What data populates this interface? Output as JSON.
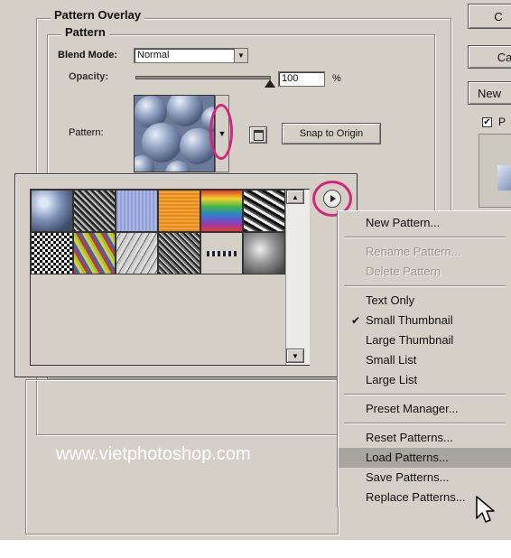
{
  "dialog": {
    "section_title": "Pattern Overlay",
    "group_title": "Pattern",
    "blend_mode_label": "Blend Mode:",
    "blend_mode_value": "Normal",
    "opacity_label": "Opacity:",
    "opacity_value": "100",
    "opacity_unit": "%",
    "opacity_level": 1.0,
    "pattern_label": "Pattern:",
    "snap_button": "Snap to Origin"
  },
  "right_panel": {
    "button_top": "C",
    "button_cancel": "Ca",
    "button_new": "New",
    "preview_checkbox": "P",
    "preview_checked": true
  },
  "picker": {
    "thumbnails": [
      "bubbles",
      "gray-noise",
      "blue-stripes",
      "orange-fabric",
      "rainbow-stripes",
      "black-white-confetti",
      "checker-dots",
      "colorful-confetti",
      "gray-scribble",
      "bw-noise",
      "chain",
      "gray-clouds"
    ]
  },
  "menu": {
    "items": [
      {
        "label": "New Pattern...",
        "enabled": true,
        "checked": false
      },
      {
        "sep": true
      },
      {
        "label": "Rename Pattern...",
        "enabled": false,
        "checked": false
      },
      {
        "label": "Delete Pattern",
        "enabled": false,
        "checked": false
      },
      {
        "sep": true
      },
      {
        "label": "Text Only",
        "enabled": true,
        "checked": false
      },
      {
        "label": "Small Thumbnail",
        "enabled": true,
        "checked": true
      },
      {
        "label": "Large Thumbnail",
        "enabled": true,
        "checked": false
      },
      {
        "label": "Small List",
        "enabled": true,
        "checked": false
      },
      {
        "label": "Large List",
        "enabled": true,
        "checked": false
      },
      {
        "sep": true
      },
      {
        "label": "Preset Manager...",
        "enabled": true,
        "checked": false
      },
      {
        "sep": true
      },
      {
        "label": "Reset Patterns...",
        "enabled": true,
        "checked": false
      },
      {
        "label": "Load Patterns...",
        "enabled": true,
        "checked": false,
        "highlighted": true
      },
      {
        "label": "Save Patterns...",
        "enabled": true,
        "checked": false
      },
      {
        "label": "Replace Patterns...",
        "enabled": true,
        "checked": false
      }
    ]
  },
  "watermark": "www.vietphotoshop.com",
  "colors": {
    "dialog_bg": "#d4d0c8",
    "highlight_ring": "#d6247a",
    "menu_highlight": "#a9a6a0"
  }
}
